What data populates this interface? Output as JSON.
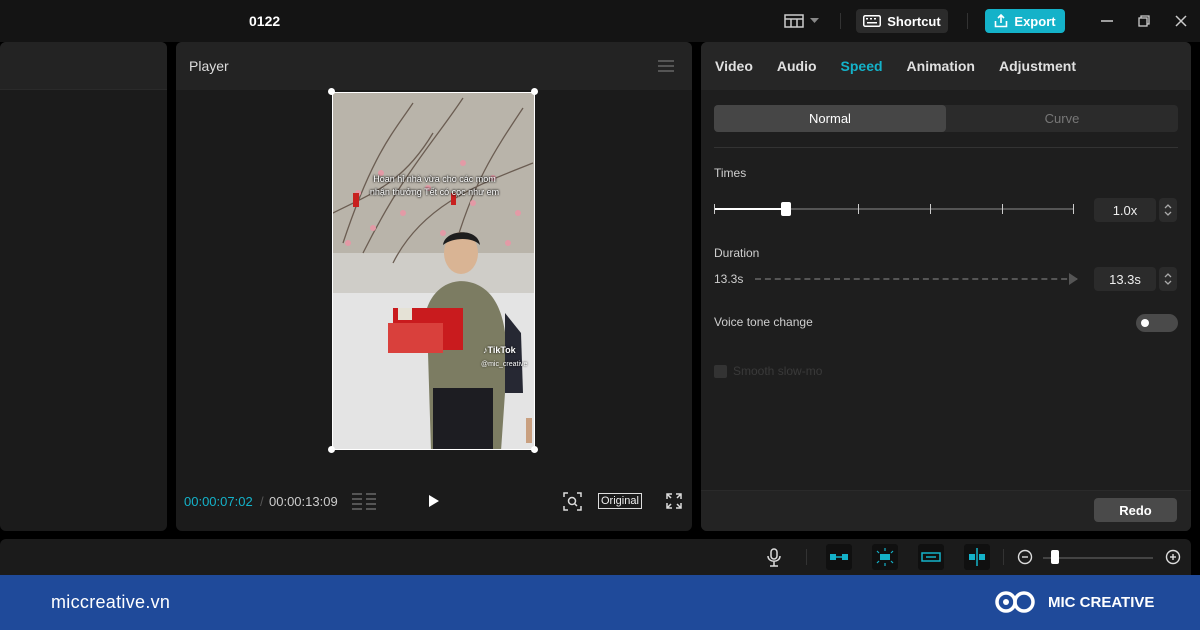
{
  "titlebar": {
    "project_name": "0122",
    "shortcut_label": "Shortcut",
    "export_label": "Export"
  },
  "player": {
    "title": "Player",
    "current_time": "00:00:07:02",
    "separator": "/",
    "total_time": "00:00:13:09",
    "original_label": "Original"
  },
  "video": {
    "caption_line1": "Hoan hỉ nhà vừa cho các mom",
    "caption_line2": "nhận thưởng Tết có cọc như em",
    "watermark": "TikTok",
    "watermark_handle": "@mic_creative"
  },
  "properties": {
    "tabs": [
      {
        "label": "Video",
        "active": false
      },
      {
        "label": "Audio",
        "active": false
      },
      {
        "label": "Speed",
        "active": true
      },
      {
        "label": "Animation",
        "active": false
      },
      {
        "label": "Adjustment",
        "active": false
      }
    ],
    "speed_modes": [
      {
        "label": "Normal",
        "active": true
      },
      {
        "label": "Curve",
        "active": false
      }
    ],
    "times_label": "Times",
    "times_value": "1.0x",
    "duration_label": "Duration",
    "duration_start": "13.3s",
    "duration_value": "13.3s",
    "voice_tone_label": "Voice tone change",
    "voice_tone_on": false,
    "smooth_slowmo_label": "Smooth slow-mo",
    "redo_label": "Redo"
  },
  "banner": {
    "site": "miccreative.vn",
    "brand": "MIC CREATIVE"
  },
  "colors": {
    "accent": "#14b2c9",
    "banner": "#1f4a9a"
  }
}
